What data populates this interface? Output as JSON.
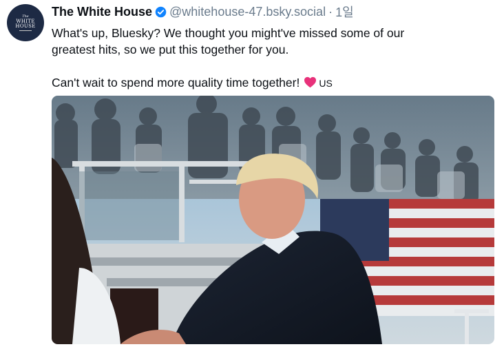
{
  "post": {
    "author": {
      "display_name": "The White House",
      "handle": "@whitehouse-47.bsky.social",
      "avatar": {
        "line1": "The",
        "line2": "WHITE",
        "line3": "HOUSE"
      },
      "verified_icon": "verified-check-icon"
    },
    "separator": "·",
    "timestamp": "1일",
    "text": {
      "paragraph1_line1": "What's up, Bluesky? We thought you might've missed some of our",
      "paragraph1_line2": "greatest hits, so we put this together for you.",
      "paragraph2": "Can't wait to spend more quality time together!",
      "emoji_icon": "heart-icon",
      "flag_text": "US"
    },
    "media": {
      "type": "image",
      "icon": "photo-image"
    }
  },
  "colors": {
    "text": "#0b0f14",
    "muted": "#6a7b8c",
    "verified": "#1083fe",
    "avatar_bg": "#1d2a44",
    "heart": "#e8317a"
  }
}
